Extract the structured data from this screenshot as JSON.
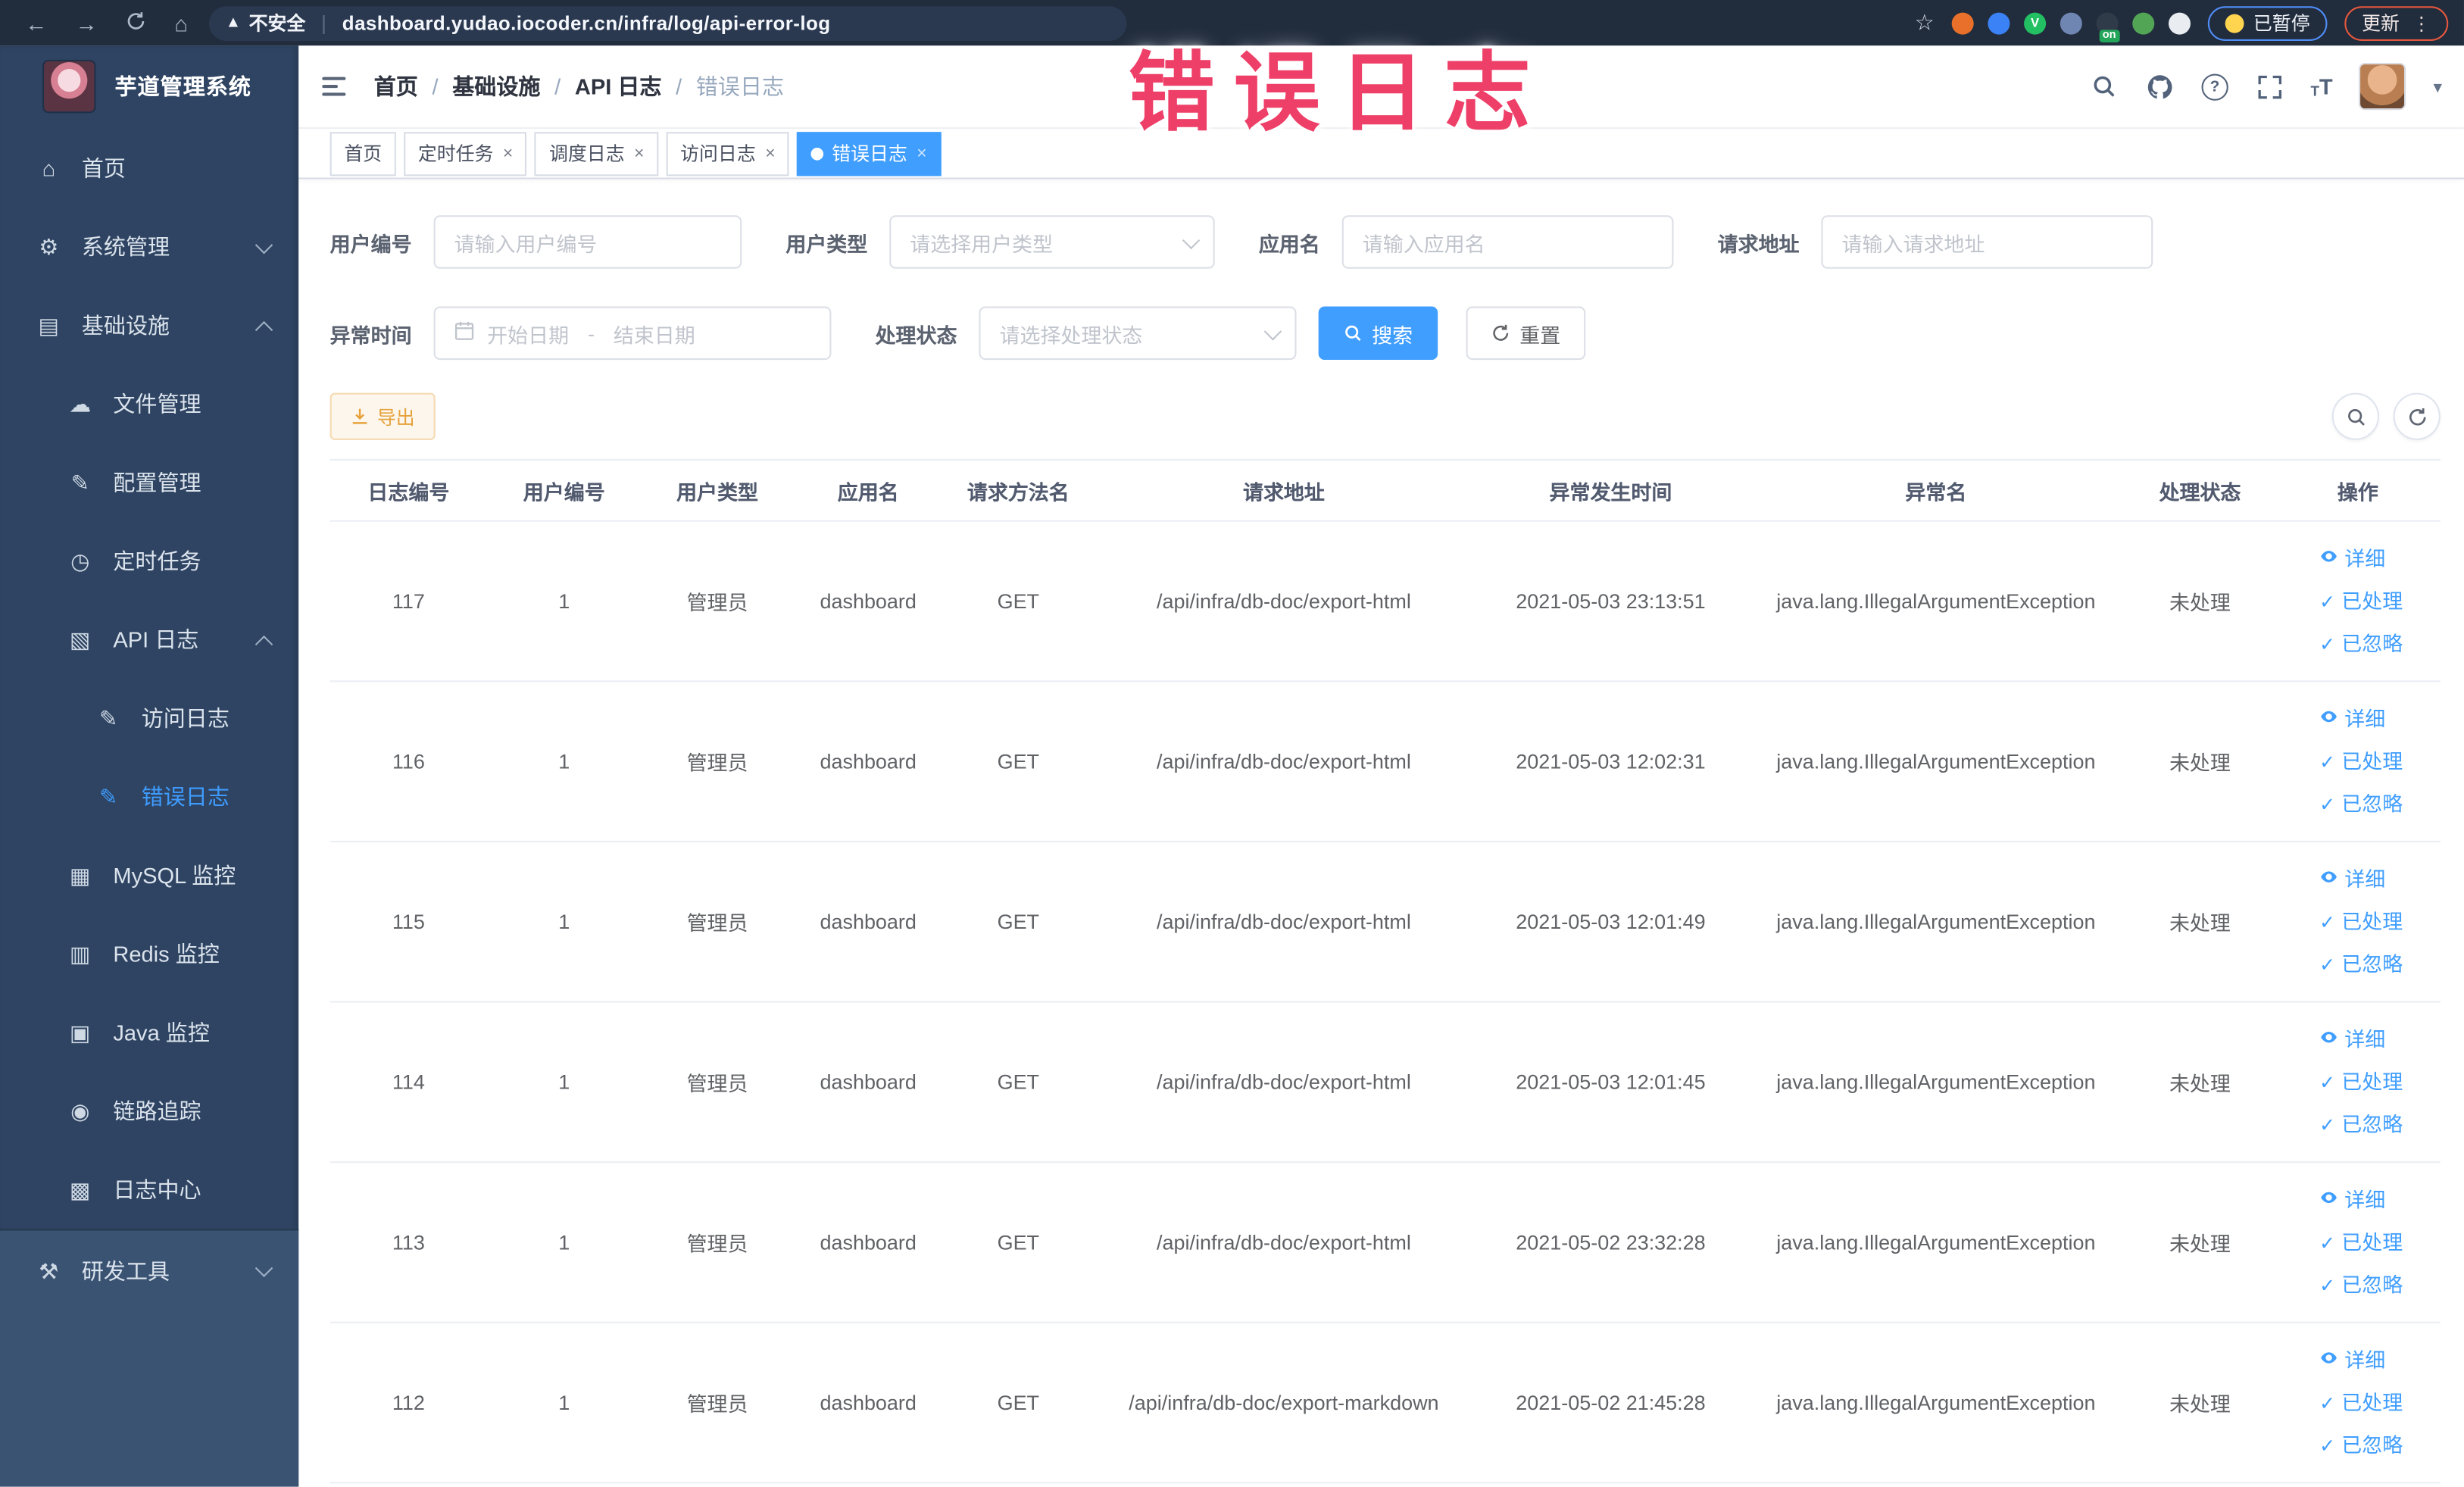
{
  "watermark": "错误日志",
  "colors": {
    "primary": "#409eff",
    "warning": "#e6a23c",
    "watermark_pink": "#ee3f68",
    "sidebar_bg": "#2e4462",
    "browser_bar_bg": "#212c3d"
  },
  "browser": {
    "security_label": "不安全",
    "url": "dashboard.yudao.iocoder.cn/infra/log/api-error-log",
    "paused_label": "已暂停",
    "update_label": "更新",
    "extensions": [
      {
        "name": "extension-orange",
        "color": "#e8702a"
      },
      {
        "name": "extension-blue-shield",
        "color": "#3b82f6"
      },
      {
        "name": "extension-green-v",
        "color": "#23c063",
        "letter": "V"
      },
      {
        "name": "extension-grid",
        "color": "#6f86b3"
      },
      {
        "name": "extension-dark",
        "color": "#303b49",
        "badge": "on"
      },
      {
        "name": "extension-leaf",
        "color": "#53a556"
      },
      {
        "name": "extension-puzzle",
        "color": "#e9edf2"
      }
    ]
  },
  "sidebar": {
    "app_title": "芋道管理系统",
    "menu": [
      {
        "label": "首页",
        "icon": "home-icon",
        "depth": 0
      },
      {
        "label": "系统管理",
        "icon": "gear-icon",
        "depth": 0,
        "chevron": "down"
      },
      {
        "label": "基础设施",
        "icon": "infrastructure-icon",
        "depth": 0,
        "chevron": "up"
      },
      {
        "label": "文件管理",
        "icon": "file-manager-icon",
        "depth": 1
      },
      {
        "label": "配置管理",
        "icon": "config-manager-icon",
        "depth": 1
      },
      {
        "label": "定时任务",
        "icon": "scheduled-task-icon",
        "depth": 1
      },
      {
        "label": "API 日志",
        "icon": "api-log-icon",
        "depth": 1,
        "chevron": "up"
      },
      {
        "label": "访问日志",
        "icon": "access-log-icon",
        "depth": 2
      },
      {
        "label": "错误日志",
        "icon": "error-log-icon",
        "depth": 2,
        "active": true
      },
      {
        "label": "MySQL 监控",
        "icon": "mysql-monitor-icon",
        "depth": 1
      },
      {
        "label": "Redis 监控",
        "icon": "redis-monitor-icon",
        "depth": 1
      },
      {
        "label": "Java 监控",
        "icon": "java-monitor-icon",
        "depth": 1
      },
      {
        "label": "链路追踪",
        "icon": "trace-icon",
        "depth": 1
      },
      {
        "label": "日志中心",
        "icon": "log-center-icon",
        "depth": 1
      }
    ],
    "devtools": {
      "label": "研发工具",
      "icon": "devtools-icon",
      "chevron": "down"
    }
  },
  "header": {
    "breadcrumb": [
      "首页",
      "基础设施",
      "API 日志",
      "错误日志"
    ]
  },
  "tabs": [
    {
      "label": "首页",
      "closable": false,
      "active": false
    },
    {
      "label": "定时任务",
      "closable": true,
      "active": false
    },
    {
      "label": "调度日志",
      "closable": true,
      "active": false
    },
    {
      "label": "访问日志",
      "closable": true,
      "active": false
    },
    {
      "label": "错误日志",
      "closable": true,
      "active": true
    }
  ],
  "filters": {
    "user_id_label": "用户编号",
    "user_id_placeholder": "请输入用户编号",
    "user_type_label": "用户类型",
    "user_type_placeholder": "请选择用户类型",
    "app_name_label": "应用名",
    "app_name_placeholder": "请输入应用名",
    "request_url_label": "请求地址",
    "request_url_placeholder": "请输入请求地址",
    "exception_time_label": "异常时间",
    "start_date_placeholder": "开始日期",
    "end_date_placeholder": "结束日期",
    "range_separator": "-",
    "process_status_label": "处理状态",
    "process_status_placeholder": "请选择处理状态",
    "search_label": "搜索",
    "reset_label": "重置"
  },
  "toolbar": {
    "export_label": "导出"
  },
  "table": {
    "columns": [
      "日志编号",
      "用户编号",
      "用户类型",
      "应用名",
      "请求方法名",
      "请求地址",
      "异常发生时间",
      "异常名",
      "处理状态",
      "操作"
    ],
    "actions": [
      "详细",
      "已处理",
      "已忽略"
    ],
    "rows": [
      {
        "id": "117",
        "user_id": "1",
        "user_type": "管理员",
        "app": "dashboard",
        "method": "GET",
        "url": "/api/infra/db-doc/export-html",
        "time": "2021-05-03 23:13:51",
        "exception": "java.lang.IllegalArgumentException",
        "status": "未处理"
      },
      {
        "id": "116",
        "user_id": "1",
        "user_type": "管理员",
        "app": "dashboard",
        "method": "GET",
        "url": "/api/infra/db-doc/export-html",
        "time": "2021-05-03 12:02:31",
        "exception": "java.lang.IllegalArgumentException",
        "status": "未处理"
      },
      {
        "id": "115",
        "user_id": "1",
        "user_type": "管理员",
        "app": "dashboard",
        "method": "GET",
        "url": "/api/infra/db-doc/export-html",
        "time": "2021-05-03 12:01:49",
        "exception": "java.lang.IllegalArgumentException",
        "status": "未处理"
      },
      {
        "id": "114",
        "user_id": "1",
        "user_type": "管理员",
        "app": "dashboard",
        "method": "GET",
        "url": "/api/infra/db-doc/export-html",
        "time": "2021-05-03 12:01:45",
        "exception": "java.lang.IllegalArgumentException",
        "status": "未处理"
      },
      {
        "id": "113",
        "user_id": "1",
        "user_type": "管理员",
        "app": "dashboard",
        "method": "GET",
        "url": "/api/infra/db-doc/export-html",
        "time": "2021-05-02 23:32:28",
        "exception": "java.lang.IllegalArgumentException",
        "status": "未处理"
      },
      {
        "id": "112",
        "user_id": "1",
        "user_type": "管理员",
        "app": "dashboard",
        "method": "GET",
        "url": "/api/infra/db-doc/export-markdown",
        "time": "2021-05-02 21:45:28",
        "exception": "java.lang.IllegalArgumentException",
        "status": "未处理"
      }
    ]
  }
}
